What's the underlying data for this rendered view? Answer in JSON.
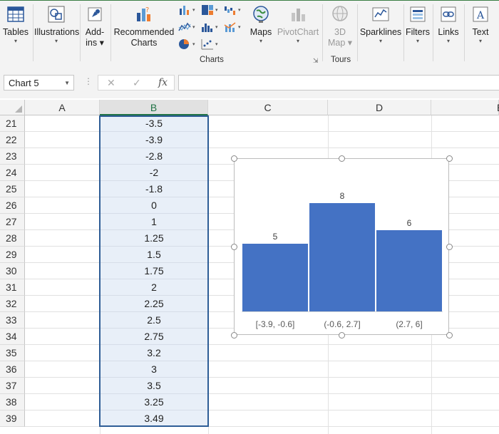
{
  "ribbon": {
    "tables": {
      "label": "Tables",
      "dd": "▾"
    },
    "illustrations": {
      "label": "Illustrations",
      "dd": "▾"
    },
    "addins": {
      "label1": "Add-",
      "label2": "ins ▾"
    },
    "recommended": {
      "label1": "Recommended",
      "label2": "Charts"
    },
    "maps": {
      "label": "Maps",
      "dd": "▾"
    },
    "pivotchart": {
      "label": "PivotChart",
      "dd": "▾"
    },
    "map3d": {
      "label1": "3D",
      "label2": "Map ▾"
    },
    "sparklines": {
      "label": "Sparklines",
      "dd": "▾"
    },
    "filters": {
      "label": "Filters",
      "dd": "▾"
    },
    "links": {
      "label": "Links",
      "dd": "▾"
    },
    "text": {
      "label": "Text",
      "dd": "▾"
    },
    "groups": {
      "charts": "Charts",
      "tours": "Tours"
    }
  },
  "formula_bar": {
    "name_box": "Chart 5",
    "cancel": "✕",
    "enter": "✓",
    "fx": "fx",
    "value": ""
  },
  "grid": {
    "columns": [
      "A",
      "B",
      "C",
      "D",
      "E"
    ],
    "rows": [
      {
        "n": "21",
        "b": "-3.5"
      },
      {
        "n": "22",
        "b": "-3.9"
      },
      {
        "n": "23",
        "b": "-2.8"
      },
      {
        "n": "24",
        "b": "-2"
      },
      {
        "n": "25",
        "b": "-1.8"
      },
      {
        "n": "26",
        "b": "0"
      },
      {
        "n": "27",
        "b": "1"
      },
      {
        "n": "28",
        "b": "1.25"
      },
      {
        "n": "29",
        "b": "1.5"
      },
      {
        "n": "30",
        "b": "1.75"
      },
      {
        "n": "31",
        "b": "2"
      },
      {
        "n": "32",
        "b": "2.25"
      },
      {
        "n": "33",
        "b": "2.5"
      },
      {
        "n": "34",
        "b": "2.75"
      },
      {
        "n": "35",
        "b": "3.2"
      },
      {
        "n": "36",
        "b": "3"
      },
      {
        "n": "37",
        "b": "3.5"
      },
      {
        "n": "38",
        "b": "3.25"
      },
      {
        "n": "39",
        "b": "3.49"
      }
    ]
  },
  "chart_data": {
    "type": "bar",
    "categories": [
      "[-3.9, -0.6]",
      "(-0.6, 2.7]",
      "(2.7, 6]"
    ],
    "values": [
      5,
      8,
      6
    ],
    "title": "",
    "xlabel": "",
    "ylabel": "",
    "ylim": [
      0,
      8
    ],
    "bar_color": "#4472c4",
    "grid": false,
    "legend": "none"
  },
  "colors": {
    "accent": "#217346",
    "selection": "#2e5d96",
    "bar": "#4472c4"
  }
}
